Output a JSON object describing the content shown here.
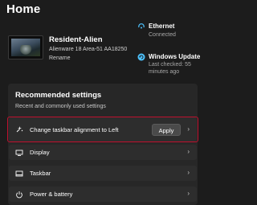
{
  "page": {
    "title": "Home"
  },
  "device": {
    "name": "Resident-Alien",
    "model": "Alienware 18 Area-51 AA18250",
    "rename_label": "Rename"
  },
  "status": {
    "ethernet": {
      "title": "Ethernet",
      "subtitle": "Connected",
      "icon": "ethernet-icon"
    },
    "windows_update": {
      "title": "Windows Update",
      "line1": "Last checked: 55",
      "line2": "minutes ago",
      "icon": "windows-update-icon"
    }
  },
  "recommended": {
    "title": "Recommended settings",
    "subtitle": "Recent and commonly used settings",
    "items": [
      {
        "label": "Change taskbar alignment to Left",
        "action": "Apply",
        "icon": "taskbar-align-icon"
      },
      {
        "label": "Display",
        "icon": "display-icon"
      },
      {
        "label": "Taskbar",
        "icon": "taskbar-icon"
      },
      {
        "label": "Power & battery",
        "icon": "power-icon"
      }
    ]
  },
  "colors": {
    "background": "#1c1c1c",
    "card": "#272727",
    "row": "#2d2d2d",
    "accent": "#4cc2ff",
    "highlight": "#c0102e"
  }
}
